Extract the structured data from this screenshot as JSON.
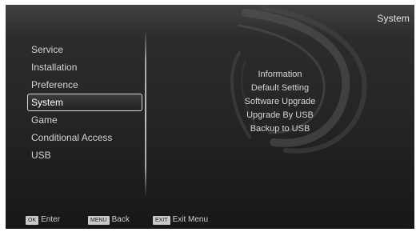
{
  "screen": {
    "title": "System"
  },
  "main_menu": {
    "items": [
      {
        "label": "Service",
        "selected": false
      },
      {
        "label": "Installation",
        "selected": false
      },
      {
        "label": "Preference",
        "selected": false
      },
      {
        "label": "System",
        "selected": true
      },
      {
        "label": "Game",
        "selected": false
      },
      {
        "label": "Conditional Access",
        "selected": false
      },
      {
        "label": "USB",
        "selected": false
      }
    ]
  },
  "submenu": {
    "items": [
      {
        "label": "Information"
      },
      {
        "label": "Default Setting"
      },
      {
        "label": "Software Upgrade"
      },
      {
        "label": "Upgrade By USB"
      },
      {
        "label": "Backup to USB"
      }
    ]
  },
  "footer": {
    "hints": [
      {
        "key": "OK",
        "label": "Enter"
      },
      {
        "key": "MENU",
        "label": "Back"
      },
      {
        "key": "EXIT",
        "label": "Exit Menu"
      }
    ]
  },
  "colors": {
    "background": "#262626",
    "text": "#d4d4d4",
    "selection_border": "#d9d9d9",
    "key_badge": "#c9c9c9"
  }
}
